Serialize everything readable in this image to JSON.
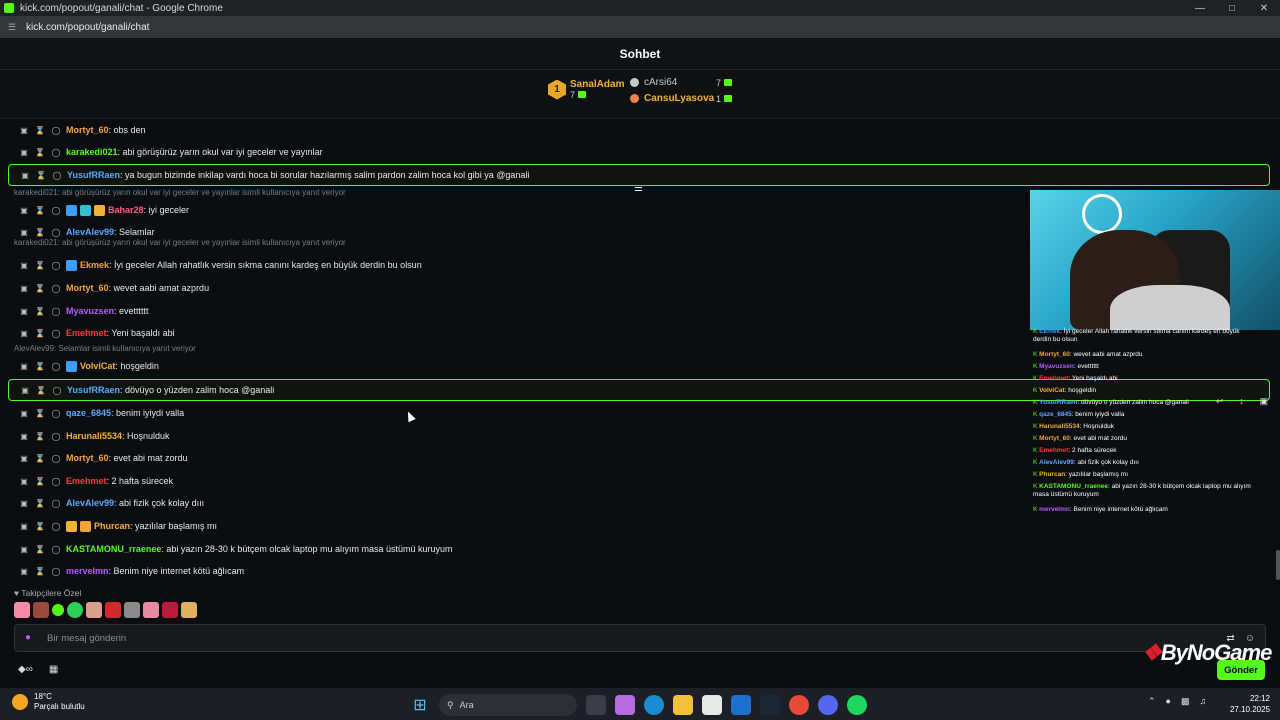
{
  "window": {
    "title": "kick.com/popout/ganali/chat - Google Chrome",
    "url": "kick.com/popout/ganali/chat"
  },
  "header": {
    "title": "Sohbet"
  },
  "leaderboard": {
    "first": {
      "rank": "1",
      "name": "SanalAdam",
      "count": "7"
    },
    "others": [
      {
        "name": "cArsi64",
        "count": "7",
        "color": "#c8c8c8"
      },
      {
        "name": "CansuLyasova",
        "count": "1",
        "color": "#f2b233"
      }
    ]
  },
  "messages": [
    {
      "user": "Mortyt_60",
      "color": "#f2a33a",
      "text": ": obs den",
      "highlight": false
    },
    {
      "user": "karakedi021",
      "color": "#53fc18",
      "text": ": abi görüşürüz yarın okul var iyi geceler ve yayınlar",
      "highlight": false
    },
    {
      "user": "YusufRRaen",
      "color": "#5aa9ff",
      "text": ": ya bugun bizimde inkilap vardı hoca bi sorular hazılarmış salim pardon zalim hoca kol gibi ya @ganali",
      "highlight": true
    },
    {
      "reply": "karakedi021: abi görüşürüz yarın okul var iyi geceler ve yayınlar isimli kullanıcıya yanıt veriyor"
    },
    {
      "user": "Bahar28",
      "color": "#ff5c8a",
      "text": ": iyi geceler",
      "highlight": false,
      "badges": [
        "#3aa0ff",
        "#35c0d0",
        "#f2b233"
      ]
    },
    {
      "user": "AlevAlev99",
      "color": "#5aa9ff",
      "text": ": Selamlar",
      "highlight": false
    },
    {
      "reply": "karakedi021: abi görüşürüz yarın okul var iyi geceler ve yayınlar isimli kullanıcıya yanıt veriyor"
    },
    {
      "user": "Ekmek",
      "color": "#f2a33a",
      "text": ": İyi geceler Allah rahatlık versin sıkma canını kardeş en büyük derdin bu olsun",
      "highlight": false,
      "badges": [
        "#3aa0ff"
      ]
    },
    {
      "user": "Mortyt_60",
      "color": "#f2a33a",
      "text": ": wevet aabi amat azprdu",
      "highlight": false
    },
    {
      "user": "Myavuzsen",
      "color": "#b65cff",
      "text": ": evetttttt",
      "highlight": false
    },
    {
      "user": "Emehmet",
      "color": "#ff3b3b",
      "text": ": Yeni başaldı abi",
      "highlight": false
    },
    {
      "reply": "AlevAlev99: Selamlar isimli kullanıcıya yanıt veriyor"
    },
    {
      "user": "VolviCat",
      "color": "#f2b233",
      "text": ": hoşgeldin",
      "highlight": false,
      "badges": [
        "#3aa0ff"
      ]
    },
    {
      "user": "YusufRRaen",
      "color": "#5aa9ff",
      "text": ": dövüyo o yüzden zalim hoca @ganali",
      "highlight": true
    },
    {
      "user": "qaze_6845",
      "color": "#5aa9ff",
      "text": ": benim iyiydi valla",
      "highlight": false
    },
    {
      "user": "Harunali5534",
      "color": "#f2b233",
      "text": ": Hoşnulduk",
      "highlight": false
    },
    {
      "user": "Mortyt_60",
      "color": "#f2a33a",
      "text": ": evet abi mat zordu",
      "highlight": false
    },
    {
      "user": "Emehmet",
      "color": "#ff3b3b",
      "text": ": 2 hafta sürecek",
      "highlight": false
    },
    {
      "user": "AlevAlev99",
      "color": "#5aa9ff",
      "text": ": abi fizik çok kolay dııı",
      "highlight": false
    },
    {
      "user": "Phurcan",
      "color": "#f2b233",
      "text": ": yazılılar başlamış mı",
      "highlight": false,
      "badges": [
        "#f2b233",
        "#f2a33a"
      ]
    },
    {
      "user": "KASTAMONU_rraenee",
      "color": "#53fc18",
      "text": ": abi yazın 28-30 k bütçem olcak laptop mu alıyım masa üstümü kuruyum",
      "highlight": false
    },
    {
      "user": "mervelmn",
      "color": "#b65cff",
      "text": ": Benim niye internet kötü ağlıcam",
      "highlight": false
    }
  ],
  "overlay": {
    "lines": [
      {
        "user": "Ekmek",
        "color": "#3aa0ff",
        "text": ": İyi geceler Allah rahatlık versin sıkma canını kardeş en büyük derdin bu olsun"
      },
      {
        "user": "Mortyt_60",
        "color": "#f2a33a",
        "text": ": wevet aabi amat azprdu"
      },
      {
        "user": "Myavuzsen",
        "color": "#b65cff",
        "text": ": evetttttt"
      },
      {
        "user": "Emehmet",
        "color": "#ff3b3b",
        "text": ": Yeni başaldı abi"
      },
      {
        "user": "VolviCat",
        "color": "#f2b233",
        "text": ": hoşgeldin"
      },
      {
        "user": "YusufRRaen",
        "color": "#5aa9ff",
        "text": ": dövüyo o yüzden zalim hoca @ganali"
      },
      {
        "user": "qaze_6845",
        "color": "#5aa9ff",
        "text": ": benim iyiydi valla"
      },
      {
        "user": "Harunali5534",
        "color": "#f2b233",
        "text": ": Hoşnulduk"
      },
      {
        "user": "Mortyt_60",
        "color": "#f2a33a",
        "text": ": evet abi mat zordu"
      },
      {
        "user": "Emehmet",
        "color": "#ff3b3b",
        "text": ": 2 hafta sürecek"
      },
      {
        "user": "AlevAlev99",
        "color": "#5aa9ff",
        "text": ": abi fizik çok kolay dııı"
      },
      {
        "user": "Phurcan",
        "color": "#f2b233",
        "text": ": yazılılar başlamış mı"
      },
      {
        "user": "KASTAMONU_rraenee",
        "color": "#53fc18",
        "text": ": abi yazın 28-30 k bütçem olcak laptop mu alıyım masa üstümü kuruyum"
      },
      {
        "user": "mervelmn",
        "color": "#b65cff",
        "text": ": Benim niye internet kötü ağlıcam"
      }
    ]
  },
  "emotes": {
    "label": "Takipçilere Özel"
  },
  "composer": {
    "placeholder": "Bir mesaj gönderin",
    "send_label": "Gönder"
  },
  "watermark": {
    "text": "ByNoGame"
  },
  "taskbar": {
    "temp": "18°C",
    "weather": "Parçalı bulutlu",
    "search": "Ara",
    "time": "22:12",
    "date": "27.10.2025"
  },
  "colors": {
    "accent": "#53fc18",
    "background": "#0b0d10"
  }
}
